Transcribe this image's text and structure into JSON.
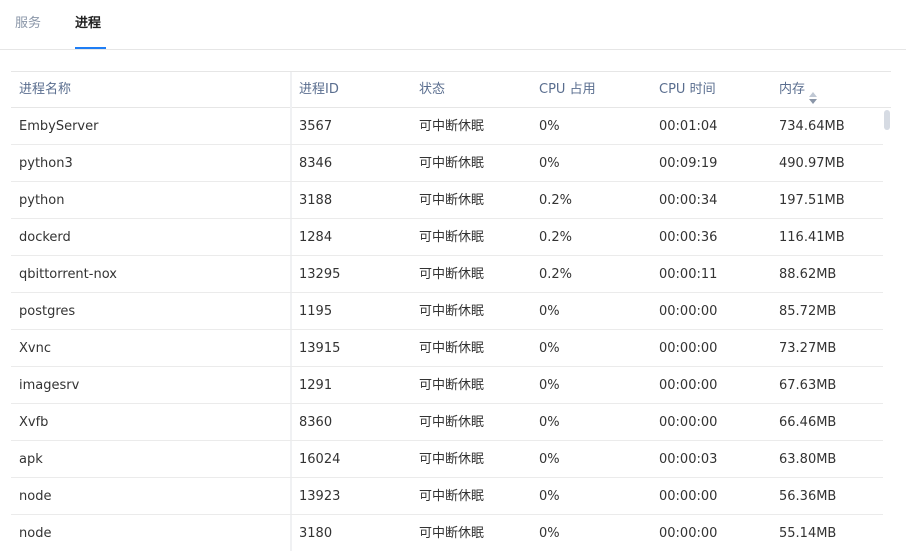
{
  "tabs": [
    {
      "label": "服务",
      "active": false
    },
    {
      "label": "进程",
      "active": true
    }
  ],
  "table": {
    "headers": {
      "name": "进程名称",
      "pid": "进程ID",
      "status": "状态",
      "cpu": "CPU 占用",
      "cpu_time": "CPU 时间",
      "memory": "内存"
    },
    "sort_icon": "sort-icon",
    "accent_color": "#1f7ef5",
    "rows": [
      {
        "name": "EmbyServer",
        "pid": "3567",
        "status": "可中断休眠",
        "cpu": "0%",
        "cpu_time": "00:01:04",
        "memory": "734.64MB"
      },
      {
        "name": "python3",
        "pid": "8346",
        "status": "可中断休眠",
        "cpu": "0%",
        "cpu_time": "00:09:19",
        "memory": "490.97MB"
      },
      {
        "name": "python",
        "pid": "3188",
        "status": "可中断休眠",
        "cpu": "0.2%",
        "cpu_time": "00:00:34",
        "memory": "197.51MB"
      },
      {
        "name": "dockerd",
        "pid": "1284",
        "status": "可中断休眠",
        "cpu": "0.2%",
        "cpu_time": "00:00:36",
        "memory": "116.41MB"
      },
      {
        "name": "qbittorrent-nox",
        "pid": "13295",
        "status": "可中断休眠",
        "cpu": "0.2%",
        "cpu_time": "00:00:11",
        "memory": "88.62MB"
      },
      {
        "name": "postgres",
        "pid": "1195",
        "status": "可中断休眠",
        "cpu": "0%",
        "cpu_time": "00:00:00",
        "memory": "85.72MB"
      },
      {
        "name": "Xvnc",
        "pid": "13915",
        "status": "可中断休眠",
        "cpu": "0%",
        "cpu_time": "00:00:00",
        "memory": "73.27MB"
      },
      {
        "name": "imagesrv",
        "pid": "1291",
        "status": "可中断休眠",
        "cpu": "0%",
        "cpu_time": "00:00:00",
        "memory": "67.63MB"
      },
      {
        "name": "Xvfb",
        "pid": "8360",
        "status": "可中断休眠",
        "cpu": "0%",
        "cpu_time": "00:00:00",
        "memory": "66.46MB"
      },
      {
        "name": "apk",
        "pid": "16024",
        "status": "可中断休眠",
        "cpu": "0%",
        "cpu_time": "00:00:03",
        "memory": "63.80MB"
      },
      {
        "name": "node",
        "pid": "13923",
        "status": "可中断休眠",
        "cpu": "0%",
        "cpu_time": "00:00:00",
        "memory": "56.36MB"
      },
      {
        "name": "node",
        "pid": "3180",
        "status": "可中断休眠",
        "cpu": "0%",
        "cpu_time": "00:00:00",
        "memory": "55.14MB"
      }
    ]
  }
}
